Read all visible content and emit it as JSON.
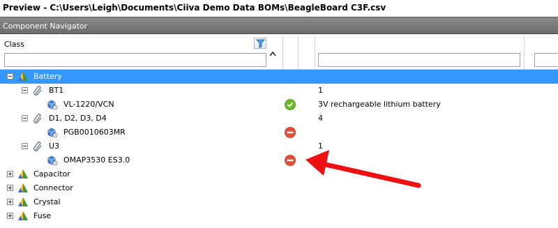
{
  "window": {
    "title": "Preview - C:\\Users\\Leigh\\Documents\\Ciiva Demo Data BOMs\\BeagleBoard C3F.csv"
  },
  "navigator": {
    "title": "Component Navigator"
  },
  "columns": {
    "class_label": "Class"
  },
  "tree": {
    "battery": {
      "label": "Battery"
    },
    "bt1": {
      "label": "BT1",
      "qty": "1"
    },
    "vl1220": {
      "label": "VL-1220/VCN",
      "description": "3V rechargeable lithium battery",
      "status": "ok"
    },
    "d1": {
      "label": "D1, D2, D3, D4",
      "qty": "4"
    },
    "pgb": {
      "label": "PGB0010603MR",
      "status": "error"
    },
    "u3": {
      "label": "U3",
      "qty": "1"
    },
    "omap": {
      "label": "OMAP3530 ES3.0",
      "status": "error"
    },
    "capacitor": {
      "label": "Capacitor"
    },
    "connector": {
      "label": "Connector"
    },
    "crystal": {
      "label": "Crystal"
    },
    "fuse": {
      "label": "Fuse"
    }
  },
  "colors": {
    "selection": "#3399ff",
    "ok": "#6ab82a",
    "error": "#e0503a",
    "arrow": "#ee1111"
  }
}
